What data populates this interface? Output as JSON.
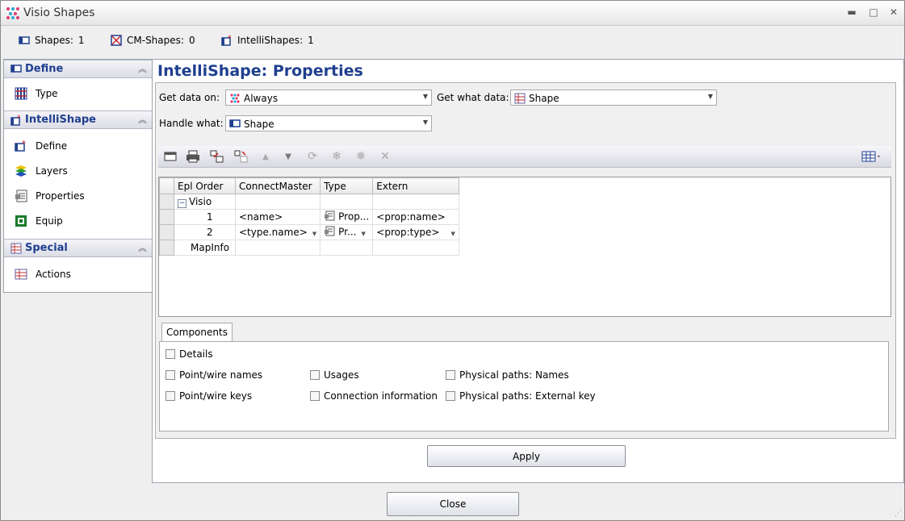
{
  "window": {
    "title": "Visio Shapes",
    "min": "▬",
    "max": "□",
    "close": "✕"
  },
  "stats": [
    {
      "label": "Shapes:",
      "value": "1"
    },
    {
      "label": "CM-Shapes:",
      "value": "0"
    },
    {
      "label": "IntelliShapes:",
      "value": "1"
    }
  ],
  "sidebar": {
    "sections": [
      {
        "title": "Define",
        "items": [
          {
            "label": "Type"
          }
        ]
      },
      {
        "title": "IntelliShape",
        "items": [
          {
            "label": "Define"
          },
          {
            "label": "Layers"
          },
          {
            "label": "Properties"
          },
          {
            "label": "Equip"
          }
        ]
      },
      {
        "title": "Special",
        "items": [
          {
            "label": "Actions"
          }
        ]
      }
    ]
  },
  "page": {
    "title": "IntelliShape:  Properties"
  },
  "fields": {
    "get_data_on": {
      "label": "Get data on:",
      "value": "Always"
    },
    "get_what_data": {
      "label": "Get what data:",
      "value": "Shape"
    },
    "handle_what": {
      "label": "Handle what:",
      "value": "Shape"
    }
  },
  "grid": {
    "columns": [
      "Epl Order",
      "ConnectMaster",
      "Type",
      "Extern"
    ],
    "rows": [
      {
        "order": "Visio",
        "master": "",
        "type": "",
        "extern": ""
      },
      {
        "order": "1",
        "master": "<name>",
        "type": "Prop...",
        "extern": "<prop:name>"
      },
      {
        "order": "2",
        "master": "<type.name>",
        "type": "Pr...",
        "extern": "<prop:type>"
      },
      {
        "order": "MapInfo",
        "master": "",
        "type": "",
        "extern": ""
      }
    ]
  },
  "components": {
    "tab_label": "Components",
    "options": {
      "details": "Details",
      "point_wire_names": "Point/wire names",
      "point_wire_keys": "Point/wire keys",
      "usages": "Usages",
      "connection_information": "Connection information",
      "physical_paths_names": "Physical paths: Names",
      "physical_paths_external_key": "Physical paths: External key"
    }
  },
  "buttons": {
    "apply": "Apply",
    "close": "Close"
  },
  "colors": {
    "accent": "#1f3f8f",
    "sidebar_header": "#dcdde6"
  }
}
